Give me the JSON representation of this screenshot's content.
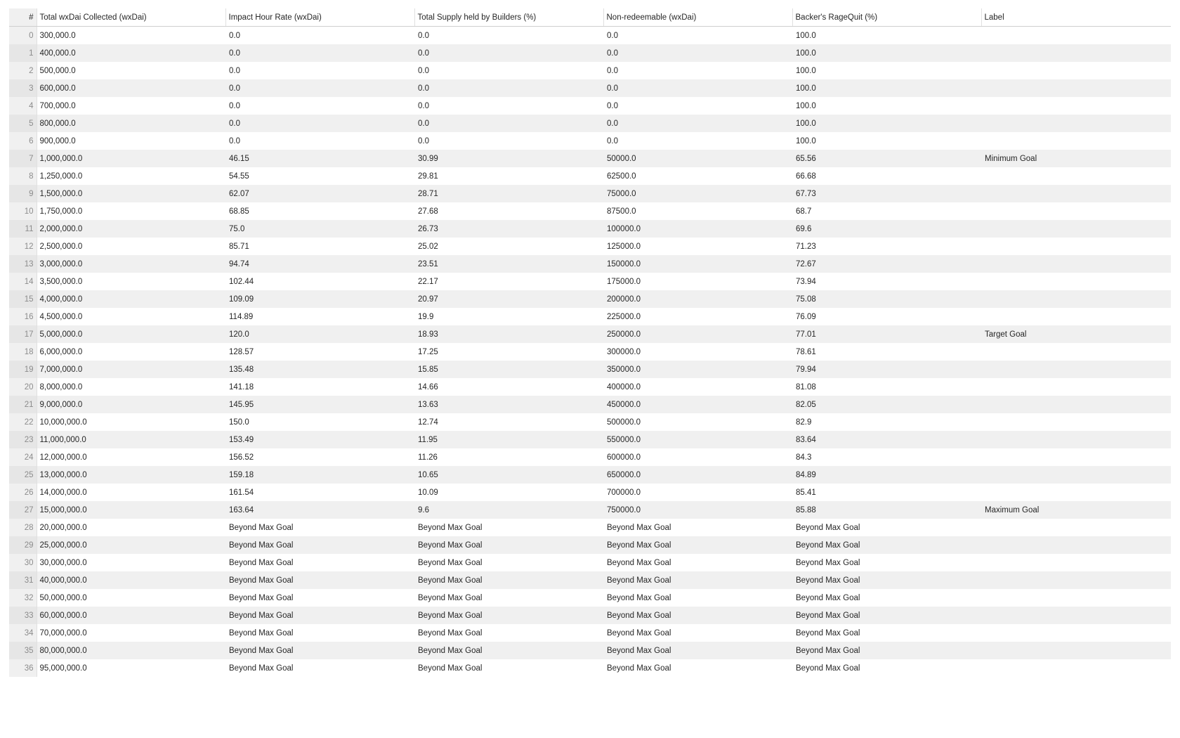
{
  "table": {
    "index_header": "#",
    "columns": [
      "Total wxDai Collected (wxDai)",
      "Impact Hour Rate (wxDai)",
      "Total Supply held by Builders (%)",
      "Non-redeemable (wxDai)",
      "Backer's RageQuit (%)",
      "Label"
    ],
    "rows": [
      [
        "0",
        "300,000.0",
        "0.0",
        "0.0",
        "0.0",
        "100.0",
        ""
      ],
      [
        "1",
        "400,000.0",
        "0.0",
        "0.0",
        "0.0",
        "100.0",
        ""
      ],
      [
        "2",
        "500,000.0",
        "0.0",
        "0.0",
        "0.0",
        "100.0",
        ""
      ],
      [
        "3",
        "600,000.0",
        "0.0",
        "0.0",
        "0.0",
        "100.0",
        ""
      ],
      [
        "4",
        "700,000.0",
        "0.0",
        "0.0",
        "0.0",
        "100.0",
        ""
      ],
      [
        "5",
        "800,000.0",
        "0.0",
        "0.0",
        "0.0",
        "100.0",
        ""
      ],
      [
        "6",
        "900,000.0",
        "0.0",
        "0.0",
        "0.0",
        "100.0",
        ""
      ],
      [
        "7",
        "1,000,000.0",
        "46.15",
        "30.99",
        "50000.0",
        "65.56",
        "Minimum Goal"
      ],
      [
        "8",
        "1,250,000.0",
        "54.55",
        "29.81",
        "62500.0",
        "66.68",
        ""
      ],
      [
        "9",
        "1,500,000.0",
        "62.07",
        "28.71",
        "75000.0",
        "67.73",
        ""
      ],
      [
        "10",
        "1,750,000.0",
        "68.85",
        "27.68",
        "87500.0",
        "68.7",
        ""
      ],
      [
        "11",
        "2,000,000.0",
        "75.0",
        "26.73",
        "100000.0",
        "69.6",
        ""
      ],
      [
        "12",
        "2,500,000.0",
        "85.71",
        "25.02",
        "125000.0",
        "71.23",
        ""
      ],
      [
        "13",
        "3,000,000.0",
        "94.74",
        "23.51",
        "150000.0",
        "72.67",
        ""
      ],
      [
        "14",
        "3,500,000.0",
        "102.44",
        "22.17",
        "175000.0",
        "73.94",
        ""
      ],
      [
        "15",
        "4,000,000.0",
        "109.09",
        "20.97",
        "200000.0",
        "75.08",
        ""
      ],
      [
        "16",
        "4,500,000.0",
        "114.89",
        "19.9",
        "225000.0",
        "76.09",
        ""
      ],
      [
        "17",
        "5,000,000.0",
        "120.0",
        "18.93",
        "250000.0",
        "77.01",
        "Target Goal"
      ],
      [
        "18",
        "6,000,000.0",
        "128.57",
        "17.25",
        "300000.0",
        "78.61",
        ""
      ],
      [
        "19",
        "7,000,000.0",
        "135.48",
        "15.85",
        "350000.0",
        "79.94",
        ""
      ],
      [
        "20",
        "8,000,000.0",
        "141.18",
        "14.66",
        "400000.0",
        "81.08",
        ""
      ],
      [
        "21",
        "9,000,000.0",
        "145.95",
        "13.63",
        "450000.0",
        "82.05",
        ""
      ],
      [
        "22",
        "10,000,000.0",
        "150.0",
        "12.74",
        "500000.0",
        "82.9",
        ""
      ],
      [
        "23",
        "11,000,000.0",
        "153.49",
        "11.95",
        "550000.0",
        "83.64",
        ""
      ],
      [
        "24",
        "12,000,000.0",
        "156.52",
        "11.26",
        "600000.0",
        "84.3",
        ""
      ],
      [
        "25",
        "13,000,000.0",
        "159.18",
        "10.65",
        "650000.0",
        "84.89",
        ""
      ],
      [
        "26",
        "14,000,000.0",
        "161.54",
        "10.09",
        "700000.0",
        "85.41",
        ""
      ],
      [
        "27",
        "15,000,000.0",
        "163.64",
        "9.6",
        "750000.0",
        "85.88",
        "Maximum Goal"
      ],
      [
        "28",
        "20,000,000.0",
        "Beyond Max Goal",
        "Beyond Max Goal",
        "Beyond Max Goal",
        "Beyond Max Goal",
        ""
      ],
      [
        "29",
        "25,000,000.0",
        "Beyond Max Goal",
        "Beyond Max Goal",
        "Beyond Max Goal",
        "Beyond Max Goal",
        ""
      ],
      [
        "30",
        "30,000,000.0",
        "Beyond Max Goal",
        "Beyond Max Goal",
        "Beyond Max Goal",
        "Beyond Max Goal",
        ""
      ],
      [
        "31",
        "40,000,000.0",
        "Beyond Max Goal",
        "Beyond Max Goal",
        "Beyond Max Goal",
        "Beyond Max Goal",
        ""
      ],
      [
        "32",
        "50,000,000.0",
        "Beyond Max Goal",
        "Beyond Max Goal",
        "Beyond Max Goal",
        "Beyond Max Goal",
        ""
      ],
      [
        "33",
        "60,000,000.0",
        "Beyond Max Goal",
        "Beyond Max Goal",
        "Beyond Max Goal",
        "Beyond Max Goal",
        ""
      ],
      [
        "34",
        "70,000,000.0",
        "Beyond Max Goal",
        "Beyond Max Goal",
        "Beyond Max Goal",
        "Beyond Max Goal",
        ""
      ],
      [
        "35",
        "80,000,000.0",
        "Beyond Max Goal",
        "Beyond Max Goal",
        "Beyond Max Goal",
        "Beyond Max Goal",
        ""
      ],
      [
        "36",
        "95,000,000.0",
        "Beyond Max Goal",
        "Beyond Max Goal",
        "Beyond Max Goal",
        "Beyond Max Goal",
        ""
      ]
    ]
  }
}
